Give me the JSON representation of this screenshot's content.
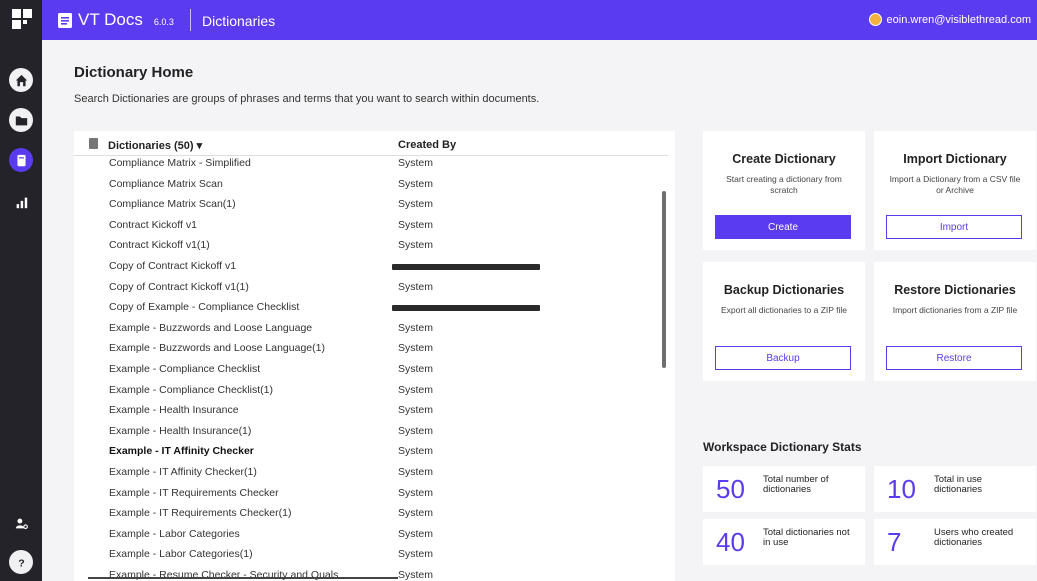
{
  "app": {
    "name": "VT Docs",
    "version": "6.0.3",
    "section": "Dictionaries"
  },
  "user": {
    "email": "eoin.wren@visiblethread.com"
  },
  "nav": {
    "items": [
      {
        "icon": "home-icon",
        "active": false
      },
      {
        "icon": "folder-icon",
        "active": false
      },
      {
        "icon": "dictionary-icon",
        "active": true
      },
      {
        "icon": "chart-icon",
        "active": false
      }
    ],
    "bottom": [
      {
        "icon": "user-settings-icon"
      },
      {
        "icon": "help-icon"
      }
    ]
  },
  "page": {
    "title": "Dictionary Home",
    "description": "Search Dictionaries are groups of phrases and terms that you want to search within documents."
  },
  "list": {
    "header_name": "Dictionaries (50) ▾",
    "header_created": "Created By",
    "rows": [
      {
        "name": "Compliance Matrix - Simplified",
        "created": "System"
      },
      {
        "name": "Compliance Matrix Scan",
        "created": "System"
      },
      {
        "name": "Compliance Matrix Scan(1)",
        "created": "System"
      },
      {
        "name": "Contract Kickoff v1",
        "created": "System"
      },
      {
        "name": "Contract Kickoff v1(1)",
        "created": "System"
      },
      {
        "name": "Copy of Contract Kickoff v1",
        "created": "",
        "redacted": true
      },
      {
        "name": "Copy of Contract Kickoff v1(1)",
        "created": "System"
      },
      {
        "name": "Copy of Example - Compliance Checklist",
        "created": "",
        "redacted": true
      },
      {
        "name": "Example - Buzzwords and Loose Language",
        "created": "System"
      },
      {
        "name": "Example - Buzzwords and Loose Language(1)",
        "created": "System"
      },
      {
        "name": "Example - Compliance Checklist",
        "created": "System"
      },
      {
        "name": "Example - Compliance Checklist(1)",
        "created": "System"
      },
      {
        "name": "Example - Health Insurance",
        "created": "System"
      },
      {
        "name": "Example - Health Insurance(1)",
        "created": "System"
      },
      {
        "name": "Example - IT Affinity Checker",
        "created": "System",
        "bold": true
      },
      {
        "name": "Example - IT Affinity Checker(1)",
        "created": "System"
      },
      {
        "name": "Example - IT Requirements Checker",
        "created": "System"
      },
      {
        "name": "Example - IT Requirements Checker(1)",
        "created": "System"
      },
      {
        "name": "Example - Labor Categories",
        "created": "System"
      },
      {
        "name": "Example - Labor Categories(1)",
        "created": "System"
      },
      {
        "name": "Example - Resume Checker - Security and Quals",
        "created": "System"
      }
    ]
  },
  "cards": {
    "create": {
      "title": "Create Dictionary",
      "desc": "Start creating a dictionary from scratch",
      "button": "Create"
    },
    "import": {
      "title": "Import Dictionary",
      "desc": "Import a Dictionary from a CSV file or Archive",
      "button": "Import"
    },
    "backup": {
      "title": "Backup Dictionaries",
      "desc": "Export all dictionaries to a ZIP file",
      "button": "Backup"
    },
    "restore": {
      "title": "Restore Dictionaries",
      "desc": "Import dictionaries from a ZIP file",
      "button": "Restore"
    }
  },
  "stats": {
    "title": "Workspace Dictionary Stats",
    "total": {
      "value": "50",
      "label": "Total number of dictionaries"
    },
    "in_use": {
      "value": "10",
      "label": "Total in use dictionaries"
    },
    "not_in_use": {
      "value": "40",
      "label": "Total dictionaries not in use"
    },
    "creators": {
      "value": "7",
      "label": "Users who created dictionaries"
    }
  },
  "colors": {
    "accent": "#5b3bf0",
    "rail": "#232329",
    "background": "#f4f4f6"
  }
}
